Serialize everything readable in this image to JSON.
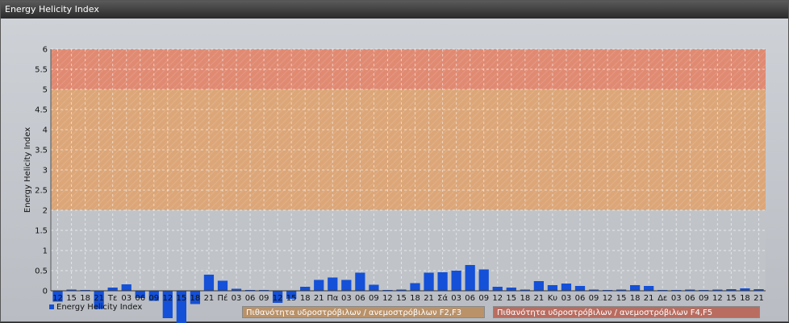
{
  "window_title": "Energy Helicity Index",
  "colors": {
    "bar": "#1450d8",
    "zone_high": "#e08a72",
    "zone_mid": "#dca678",
    "legend_mid": "#b9926a",
    "legend_high": "#b86d60"
  },
  "chart_data": {
    "type": "bar",
    "title": "",
    "xlabel": "",
    "ylabel": "Energy Helicity Index",
    "ylim": [
      0,
      6
    ],
    "yticks": [
      "0",
      "0.5",
      "1",
      "1.5",
      "2",
      "2.5",
      "3",
      "3.5",
      "4",
      "4.5",
      "5",
      "5.5",
      "6"
    ],
    "grid": true,
    "legend_placement": "bottom",
    "categories": [
      "12",
      "15",
      "18",
      "21",
      "Τε",
      "03",
      "06",
      "09",
      "12",
      "15",
      "18",
      "21",
      "Πέ",
      "03",
      "06",
      "09",
      "12",
      "15",
      "18",
      "21",
      "Πα",
      "03",
      "06",
      "09",
      "12",
      "15",
      "18",
      "21",
      "Σά",
      "03",
      "06",
      "09",
      "12",
      "15",
      "18",
      "21",
      "Κυ",
      "03",
      "06",
      "09",
      "12",
      "15",
      "18",
      "21",
      "Δε",
      "03",
      "06",
      "09",
      "12",
      "15",
      "18",
      "21"
    ],
    "series": [
      {
        "name": "Energy Helicity Index",
        "values": [
          -0.27,
          0.03,
          0.02,
          -0.45,
          0.08,
          0.16,
          -0.18,
          -0.25,
          -0.68,
          -0.8,
          -0.33,
          0.4,
          0.25,
          0.05,
          0.02,
          0.02,
          -0.3,
          -0.2,
          0.1,
          0.27,
          0.33,
          0.27,
          0.45,
          0.15,
          0.02,
          0.03,
          0.19,
          0.45,
          0.46,
          0.5,
          0.64,
          0.53,
          0.1,
          0.08,
          0.03,
          0.24,
          0.14,
          0.18,
          0.12,
          0.03,
          0.02,
          0.03,
          0.14,
          0.12,
          0.02,
          0.02,
          0.03,
          0.02,
          0.03,
          0.04,
          0.06,
          0.04
        ]
      }
    ],
    "bands": [
      {
        "label": "Πιθανότητα υδροστρόβιλων / ανεμοστρόβιλων F2,F3",
        "from": 2,
        "to": 5
      },
      {
        "label": "Πιθανότητα υδροστρόβιλων / ανεμοστρόβιλων F4,F5",
        "from": 5,
        "to": 6
      }
    ]
  }
}
